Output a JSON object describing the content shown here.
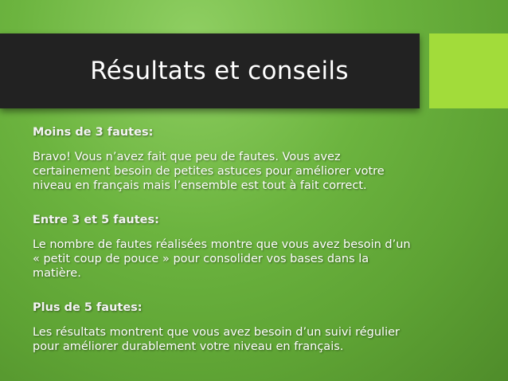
{
  "slide": {
    "title": "Résultats et conseils",
    "sections": [
      {
        "heading": "Moins de 3 fautes:",
        "lines": [
          "Bravo! Vous n’avez fait que peu de fautes. Vous avez",
          "certainement besoin de petites astuces pour améliorer votre",
          "niveau en français mais l’ensemble est tout à fait correct."
        ]
      },
      {
        "heading": "Entre 3 et 5 fautes:",
        "lines": [
          "Le nombre de fautes réalisées montre que vous avez besoin d’un",
          "« petit coup de pouce » pour consolider vos bases dans la",
          "matière."
        ]
      },
      {
        "heading": "Plus de 5 fautes:",
        "lines": [
          "Les résultats montrent que vous avez besoin d’un suivi régulier",
          "pour améliorer durablement votre niveau en français."
        ]
      }
    ]
  },
  "colors": {
    "title_bar": "#222222",
    "accent_square": "#a2dc3a",
    "background": "#6cb43f"
  }
}
